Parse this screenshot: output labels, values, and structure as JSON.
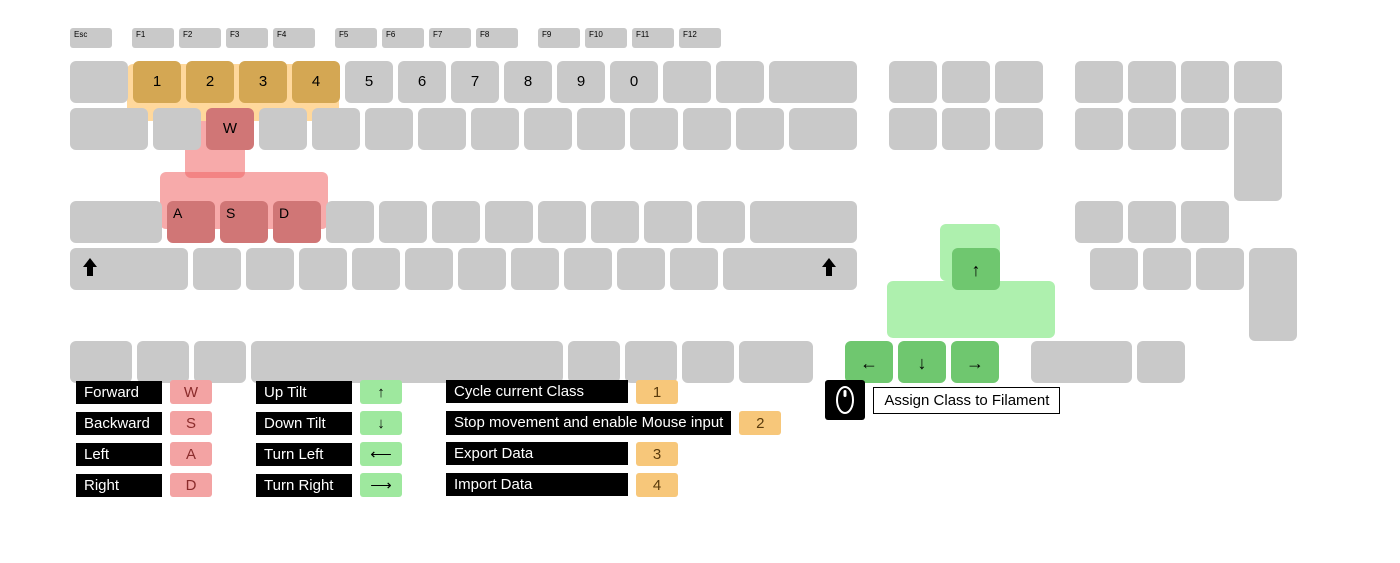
{
  "function_row": [
    "F1",
    "F2",
    "F3",
    "F4",
    "F5",
    "F6",
    "F7",
    "F8",
    "F9",
    "F10",
    "F11",
    "F12"
  ],
  "esc": "Esc",
  "number_row": [
    "1",
    "2",
    "3",
    "4",
    "5",
    "6",
    "7",
    "8",
    "9",
    "0"
  ],
  "wasd": {
    "w": "W",
    "a": "A",
    "s": "S",
    "d": "D"
  },
  "highlights": {
    "numbers": [
      "1",
      "2",
      "3",
      "4"
    ],
    "wasd": [
      "W",
      "A",
      "S",
      "D"
    ],
    "arrows": [
      "↑",
      "←",
      "↓",
      "→"
    ]
  },
  "legend": {
    "movement": [
      {
        "label": "Forward",
        "key": "W"
      },
      {
        "label": "Backward",
        "key": "S"
      },
      {
        "label": "Left",
        "key": "A"
      },
      {
        "label": "Right",
        "key": "D"
      }
    ],
    "tilt": [
      {
        "label": "Up Tilt",
        "icon": "↑"
      },
      {
        "label": "Down Tilt",
        "icon": "↓"
      },
      {
        "label": "Turn Left",
        "icon": "⟵"
      },
      {
        "label": "Turn Right",
        "icon": "⟶"
      }
    ],
    "actions": [
      {
        "label": "Cycle current Class",
        "key": "1"
      },
      {
        "label": "Stop movement and enable Mouse input",
        "key": "2"
      },
      {
        "label": "Export Data",
        "key": "3"
      },
      {
        "label": "Import Data",
        "key": "4"
      }
    ],
    "mouse": {
      "label": "Assign Class to Filament"
    }
  }
}
